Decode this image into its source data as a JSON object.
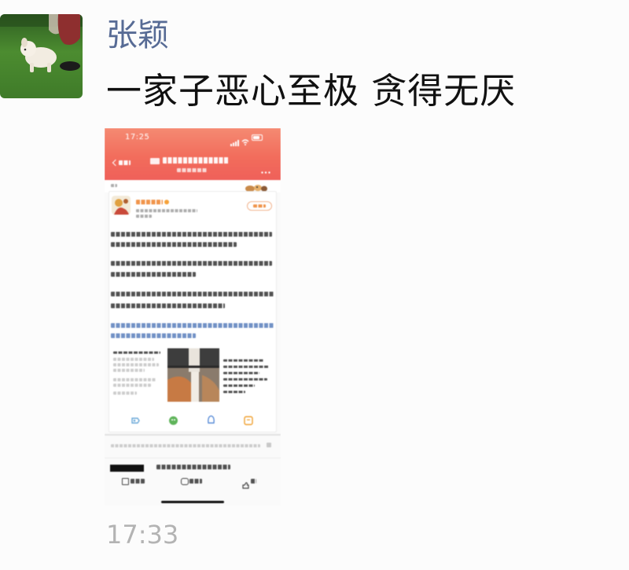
{
  "post": {
    "author_name": "张颖",
    "content": "一家子恶心至极 贪得无厌",
    "timestamp": "17:33"
  },
  "embedded_screenshot": {
    "status_time": "17:25"
  },
  "colors": {
    "background": "#fcfcfc",
    "author_name": "#576b95",
    "content_text": "#111111",
    "timestamp": "#b3b3b3",
    "screenshot_header": "#f26d5c",
    "screenshot_link_text": "#5a7fbc",
    "screenshot_name_text": "#ef8a3a"
  },
  "icons": {
    "avatar": "user-avatar-photo",
    "back": "chevron-left-icon",
    "more": "more-dots-icon",
    "share_row": [
      "share-moments-icon",
      "share-wechat-icon",
      "share-qq-icon",
      "share-note-icon"
    ],
    "tab_row": [
      "repost-icon",
      "comment-icon",
      "like-icon"
    ]
  }
}
